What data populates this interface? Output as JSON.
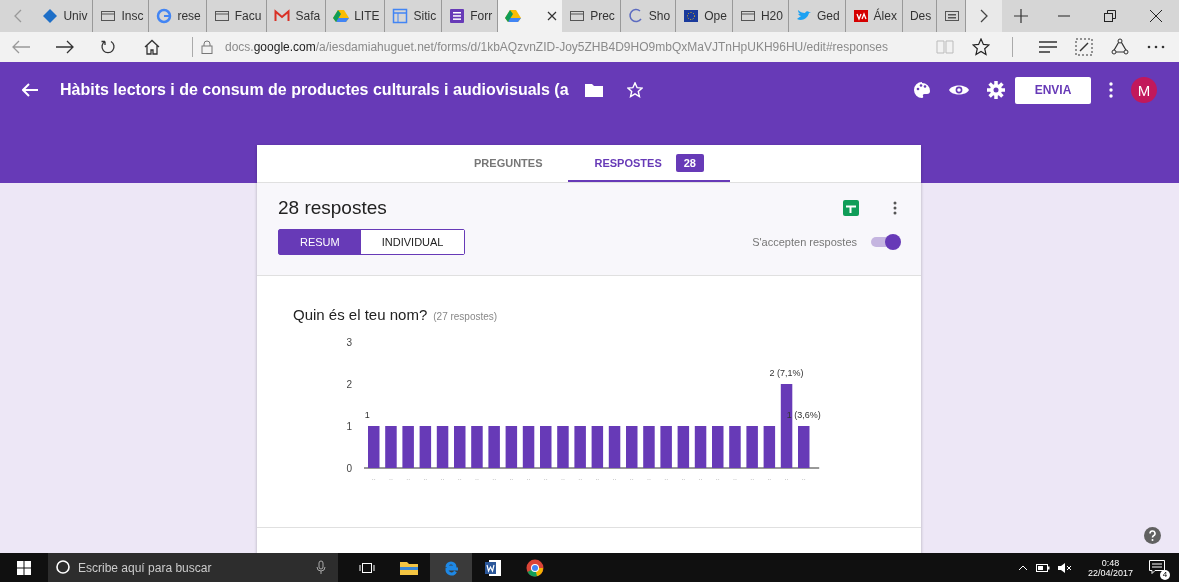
{
  "browser": {
    "tabs": [
      {
        "label": "Univ",
        "kind": "diamond",
        "selected": false
      },
      {
        "label": "Insc",
        "kind": "page",
        "selected": false
      },
      {
        "label": "rese",
        "kind": "google",
        "selected": false
      },
      {
        "label": "Facu",
        "kind": "page",
        "selected": false
      },
      {
        "label": "Safa",
        "kind": "mail",
        "selected": false
      },
      {
        "label": "LITE",
        "kind": "drive",
        "selected": false
      },
      {
        "label": "Sitic",
        "kind": "sites",
        "selected": false
      },
      {
        "label": "Forr",
        "kind": "forms",
        "selected": false
      },
      {
        "kind": "drive",
        "selected": true
      },
      {
        "label": "Prec",
        "kind": "page",
        "selected": false
      },
      {
        "label": "Sho",
        "kind": "loading",
        "selected": false
      },
      {
        "label": "Ope",
        "kind": "flag",
        "selected": false
      },
      {
        "label": "H20",
        "kind": "page",
        "selected": false
      },
      {
        "label": "Ged",
        "kind": "bird",
        "selected": false
      },
      {
        "label": "Álex",
        "kind": "logo",
        "selected": false
      },
      {
        "label": "Des",
        "kind": "plain",
        "selected": false
      },
      {
        "kind": "keyboard",
        "selected": false
      }
    ],
    "url": "docs.**google.com**/a/iesdamiahuguet.net/forms/d/1kbAQzvnZID-Joy5ZHB4D9HO9mbQxMaVJTnHpUKH96HU/edit#responses"
  },
  "form": {
    "title": "Hàbits lectors i de consum de productes culturals i audiovisuals (a",
    "send_button": "ENVIA",
    "avatar": "M",
    "tabs": [
      {
        "label": "PREGUNTES",
        "selected": false
      },
      {
        "label": "RESPOSTES",
        "selected": true,
        "badge": "28"
      }
    ],
    "summary": {
      "heading": "28 respostes",
      "views": [
        {
          "label": "RESUM",
          "selected": true
        },
        {
          "label": "INDIVIDUAL",
          "selected": false
        }
      ],
      "accepting_label": "S'accepten respostes",
      "accepting": true
    },
    "question": {
      "title": "Quin és el teu nom?",
      "count": "(27 respostes)",
      "chart_data": {
        "type": "bar",
        "categories": [
          "..",
          "..",
          "..",
          "..",
          "..",
          "..",
          "..",
          "..",
          "..",
          "..",
          "..",
          "..",
          "..",
          "..",
          "..",
          "..",
          "..",
          "..",
          "..",
          "..",
          "..",
          "..",
          "..",
          "..",
          "..",
          ".."
        ],
        "values": [
          1,
          1,
          1,
          1,
          1,
          1,
          1,
          1,
          1,
          1,
          1,
          1,
          1,
          1,
          1,
          1,
          1,
          1,
          1,
          1,
          1,
          1,
          1,
          1,
          2,
          1
        ],
        "value_labels": [
          "1",
          null,
          null,
          null,
          null,
          null,
          null,
          null,
          null,
          null,
          null,
          null,
          null,
          null,
          null,
          null,
          null,
          null,
          null,
          null,
          null,
          null,
          null,
          null,
          "2 (7,1%)",
          "1 (3,6%)"
        ],
        "ylim": [
          0,
          3
        ],
        "yticks": [
          0,
          1,
          2,
          3
        ]
      }
    }
  },
  "taskbar": {
    "search_placeholder": "Escribe aquí para buscar",
    "time": "0:48",
    "date": "22/04/2017",
    "notifications": "4"
  }
}
